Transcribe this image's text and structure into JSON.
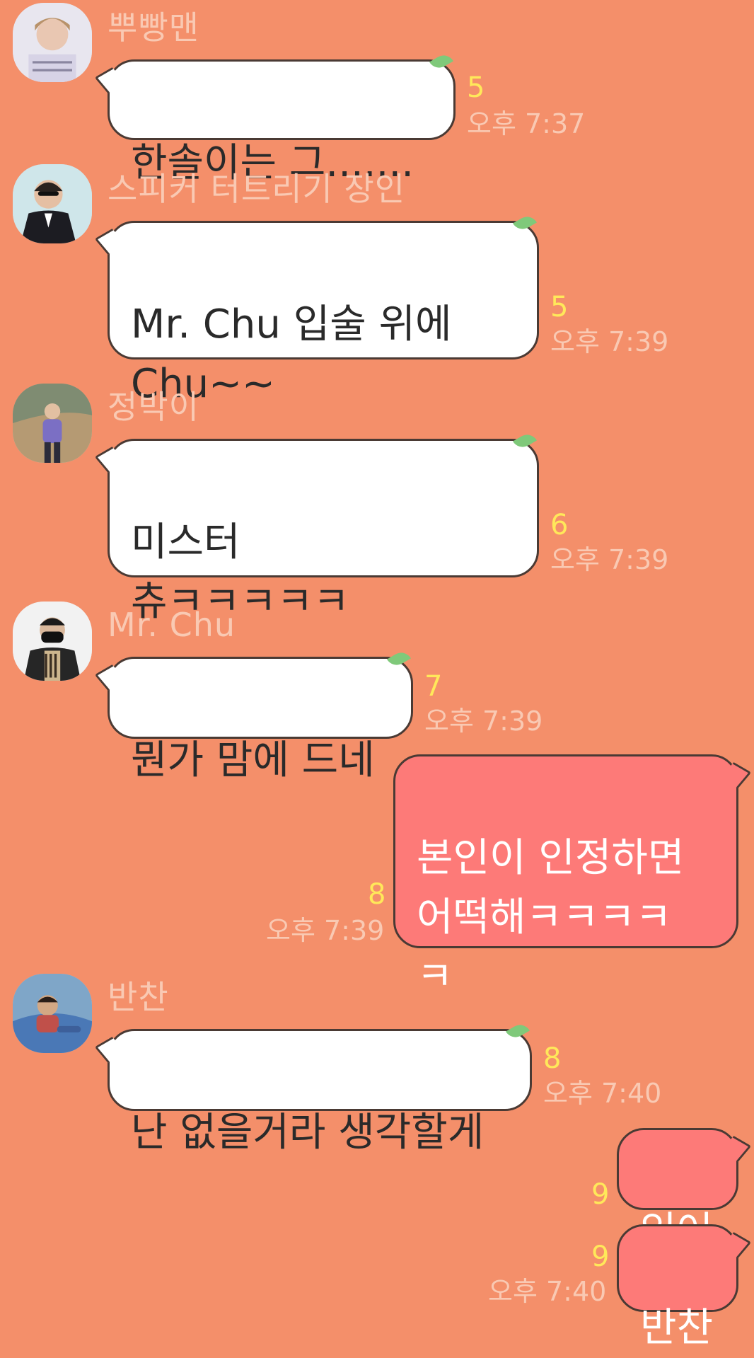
{
  "messages": [
    {
      "sender": "뿌빵맨",
      "text": "한솔이는 그.......",
      "unread": "5",
      "time": "오후 7:37"
    },
    {
      "sender": "스피커 터트리기 장인",
      "text": "Mr. Chu 입술 위에\nChu~~",
      "unread": "5",
      "time": "오후 7:39"
    },
    {
      "sender": "정박이",
      "text": "미스터\n츄ㅋㅋㅋㅋㅋ",
      "unread": "6",
      "time": "오후 7:39"
    },
    {
      "sender": "Mr. Chu",
      "text": "뭔가 맘에 드네",
      "unread": "7",
      "time": "오후 7:39"
    },
    {
      "mine": true,
      "text": "본인이 인정하면\n어떡해ㅋㅋㅋㅋ\nㅋ",
      "unread": "8",
      "time": "오후 7:39"
    },
    {
      "sender": "반찬",
      "text": "난 없을거라 생각할게",
      "unread": "8",
      "time": "오후 7:40"
    },
    {
      "mine": true,
      "text": "있어",
      "unread": "9"
    },
    {
      "mine": true,
      "text": "반찬",
      "unread": "9",
      "time": "오후 7:40"
    }
  ],
  "colors": {
    "background": "#f48f6a",
    "incoming_bubble": "#ffffff",
    "outgoing_bubble": "#fd7a78",
    "unread_count": "#ffe85a",
    "meta_text": "#f9c9b3"
  }
}
